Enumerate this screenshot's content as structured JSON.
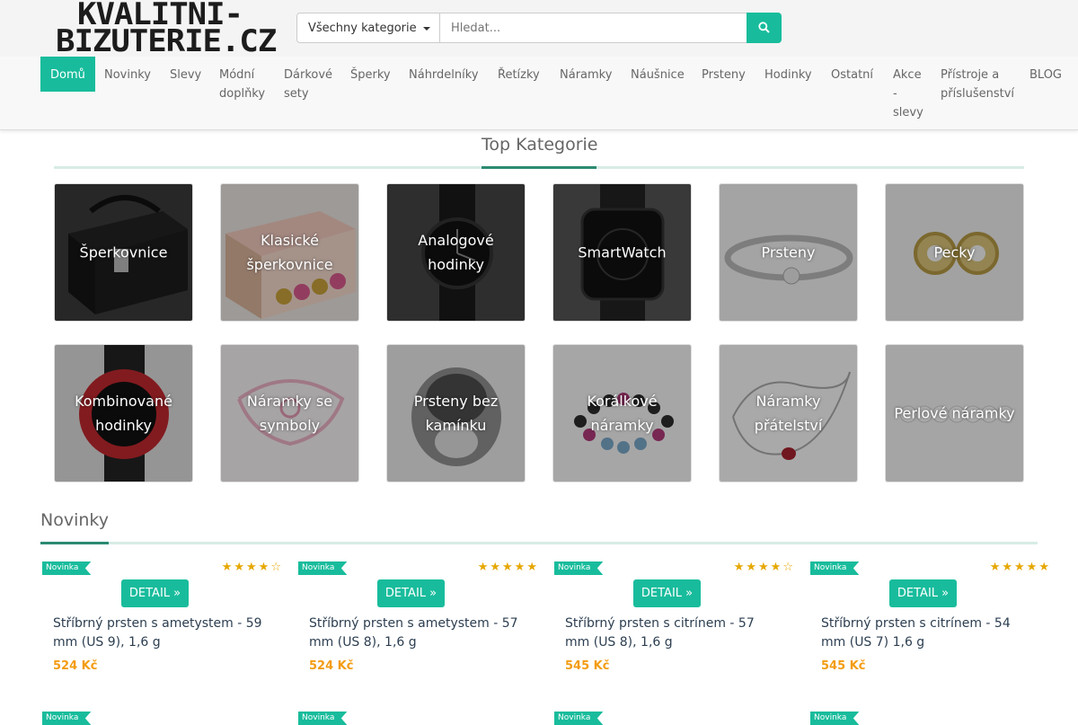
{
  "logo": {
    "line1": "KVALITNI-",
    "line2": "BIZUTERIE.CZ"
  },
  "search": {
    "category": "Všechny kategorie",
    "placeholder": "Hledat..."
  },
  "colors": {
    "accent": "#18bc9c",
    "price": "#f39c12",
    "stars": "#e6a700"
  },
  "nav": [
    {
      "label": "Domů"
    },
    {
      "label": "Novinky"
    },
    {
      "label": "Slevy"
    },
    {
      "label": "Módní\ndoplňky"
    },
    {
      "label": "Dárkové\nsety"
    },
    {
      "label": "Šperky"
    },
    {
      "label": "Náhrdelníky"
    },
    {
      "label": "Řetízky"
    },
    {
      "label": "Náramky"
    },
    {
      "label": "Náušnice"
    },
    {
      "label": "Prsteny"
    },
    {
      "label": "Hodinky"
    },
    {
      "label": "Ostatní"
    },
    {
      "label": "Akce\n-\nslevy"
    },
    {
      "label": "Přístroje a\npříslušenství"
    },
    {
      "label": "BLOG"
    }
  ],
  "top_categories": {
    "title": "Top Kategorie",
    "items": [
      {
        "label": "Šperkovnice",
        "icon": "jewelry-box-icon"
      },
      {
        "label": "Klasické šperkovnice",
        "icon": "owl-box-icon"
      },
      {
        "label": "Analogové hodinky",
        "icon": "analog-watch-icon"
      },
      {
        "label": "SmartWatch",
        "icon": "smartwatch-icon"
      },
      {
        "label": "Prsteny",
        "icon": "ring-icon"
      },
      {
        "label": "Pecky",
        "icon": "stud-earrings-icon"
      },
      {
        "label": "Kombinované hodinky",
        "icon": "combined-watch-icon"
      },
      {
        "label": "Náramky se symboly",
        "icon": "symbol-bracelet-icon"
      },
      {
        "label": "Prsteny bez kamínku",
        "icon": "plain-ring-icon"
      },
      {
        "label": "Korálkové náramky",
        "icon": "bead-bracelet-icon"
      },
      {
        "label": "Náramky přátelství",
        "icon": "friendship-bracelet-icon"
      },
      {
        "label": "Perlové náramky",
        "icon": "pearl-bracelet-icon"
      }
    ]
  },
  "novinky": {
    "title": "Novinky",
    "products": [
      {
        "badge": "Novinka",
        "rating": 4,
        "button": "DETAIL »",
        "name": "Stříbrný prsten s ametystem - 59 mm (US 9), 1,6 g",
        "price": "524 Kč"
      },
      {
        "badge": "Novinka",
        "rating": 5,
        "button": "DETAIL »",
        "name": "Stříbrný prsten s ametystem - 57 mm (US 8), 1,6 g",
        "price": "524 Kč"
      },
      {
        "badge": "Novinka",
        "rating": 4,
        "button": "DETAIL »",
        "name": "Stříbrný prsten s citrínem - 57 mm (US 8), 1,6 g",
        "price": "545 Kč"
      },
      {
        "badge": "Novinka",
        "rating": 5,
        "button": "DETAIL »",
        "name": "Stříbrný prsten s citrínem - 54 mm (US 7) 1,6 g",
        "price": "545 Kč"
      }
    ]
  }
}
